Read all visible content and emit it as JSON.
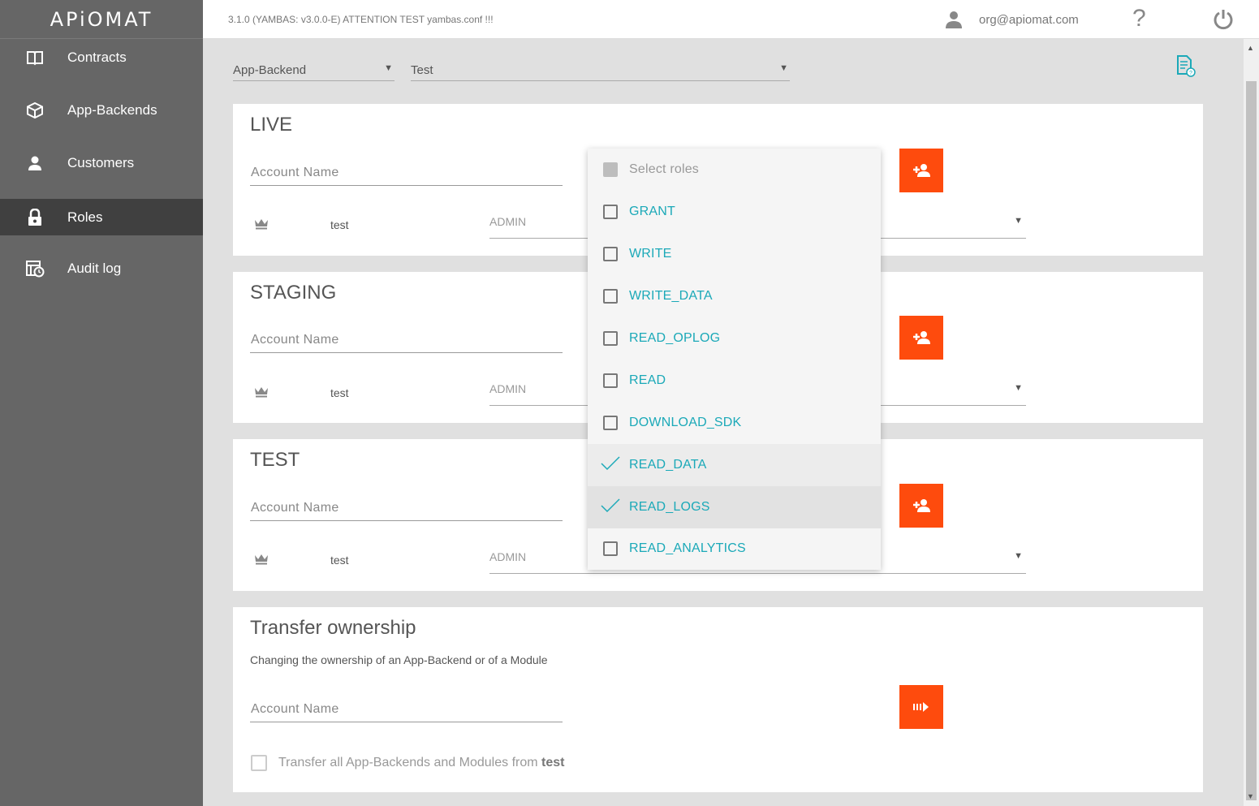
{
  "app": {
    "logo": "APiOMAT",
    "version": "3.1.0 (YAMBAS: v3.0.0-E) ATTENTION TEST yambas.conf !!!",
    "user_email": "org@apiomat.com",
    "help": "?"
  },
  "sidebar": {
    "items": [
      {
        "label": "Contracts",
        "icon": "book-icon"
      },
      {
        "label": "App-Backends",
        "icon": "cube-icon"
      },
      {
        "label": "Customers",
        "icon": "person-icon"
      },
      {
        "label": "Roles",
        "icon": "lock-icon",
        "active": true
      },
      {
        "label": "Audit log",
        "icon": "audit-log-icon"
      }
    ]
  },
  "filters": {
    "type_value": "App-Backend",
    "backend_value": "Test"
  },
  "sections": [
    {
      "title": "LIVE",
      "account_placeholder": "Account Name",
      "member": "test",
      "role": "ADMIN"
    },
    {
      "title": "STAGING",
      "account_placeholder": "Account Name",
      "member": "test",
      "role": "ADMIN"
    },
    {
      "title": "TEST",
      "account_placeholder": "Account Name",
      "member": "test",
      "role": "ADMIN"
    }
  ],
  "transfer": {
    "title": "Transfer ownership",
    "description": "Changing the ownership of an App-Backend or of a Module",
    "account_placeholder": "Account Name",
    "checkbox_label": "Transfer all App-Backends and Modules from",
    "checkbox_target": "test"
  },
  "roles_dropdown": {
    "header": "Select roles",
    "items": [
      {
        "label": "GRANT",
        "checked": false
      },
      {
        "label": "WRITE",
        "checked": false
      },
      {
        "label": "WRITE_DATA",
        "checked": false
      },
      {
        "label": "READ_OPLOG",
        "checked": false
      },
      {
        "label": "READ",
        "checked": false
      },
      {
        "label": "DOWNLOAD_SDK",
        "checked": false
      },
      {
        "label": "READ_DATA",
        "checked": true
      },
      {
        "label": "READ_LOGS",
        "checked": true
      },
      {
        "label": "READ_ANALYTICS",
        "checked": false
      }
    ]
  },
  "colors": {
    "accent": "#fe4b0d",
    "sidebar": "#666666",
    "sidebar_active": "#404040",
    "link": "#1ba9b8"
  }
}
